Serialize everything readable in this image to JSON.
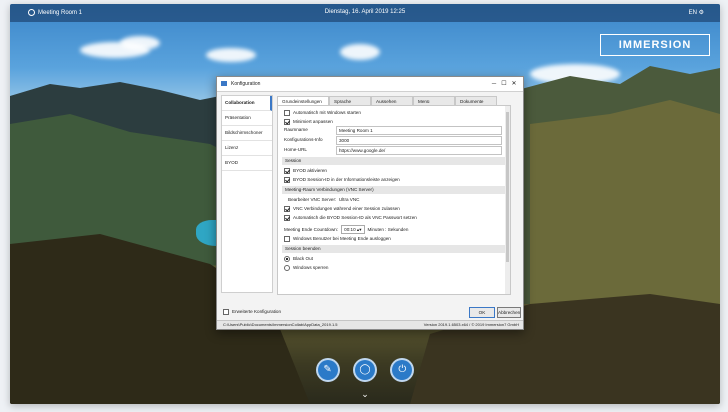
{
  "topbar": {
    "room": "Meeting Room 1",
    "datetime": "Dienstag, 16. April 2019 12:25",
    "lang": "EN"
  },
  "logo": "IMMERSION",
  "dialog": {
    "title": "Konfiguration",
    "sidebar": [
      "Collaboration",
      "Präsentation",
      "Bildschirmschoner",
      "Lizenz",
      "BYOD"
    ],
    "tabs": [
      "Grundeinstellungen",
      "Sprache",
      "Aussehen",
      "Menü",
      "Dokumente"
    ],
    "checkbox_autostart": "Automatisch mit Windows starten",
    "checkbox_minimize": "Minimiert anpassen",
    "field_room_label": "Raumname",
    "field_room_value": "Meeting Room 1",
    "field_config_label": "Konfigurations-Info",
    "field_config_value": "3000",
    "field_url_label": "Home-URL",
    "field_url_value": "https://www.google.de/",
    "section_session": "Session",
    "byod_enable": "BYOD aktivieren",
    "byod_session": "BYOD Session-ID in der Informationsleiste anzeigen",
    "section_vnc": "Meeting-Raum Verbindungen (VNC Server)",
    "vnc_server_label": "Bearbeiter VNC Server:",
    "vnc_server_value": "Ultra VNC",
    "vnc_connect": "VNC Verbindungen während einer Session zulassen",
    "vnc_auto": "Automatisch die BYOD Session-ID als VNC Passwort setzen",
    "countdown_label": "Meeting Ende Countdown:",
    "countdown_value": "00:10",
    "countdown_unit": "Minuten : Sekunden",
    "windows_logout": "Windows Benutzer bei Meeting Ende ausloggen",
    "section_session_end": "Session beenden",
    "radio_blackout": "Black Out",
    "radio_windows": "Windows sperren",
    "checkbox_extended": "Erweiterte Konfiguration",
    "ok": "OK",
    "cancel": "Abbrechen",
    "status_path": "C:\\Users\\Public\\Documents\\ImmersionCollab\\AppData_2019.1.5",
    "status_version": "Version 2019.1.6503.x64 / © 2019 Immersion7 GmbH"
  },
  "colors": {
    "accent": "#3b78c6",
    "dock_button": "#2b7ac8"
  },
  "dock_icons": [
    "pen-icon",
    "circle-icon",
    "power-icon"
  ]
}
